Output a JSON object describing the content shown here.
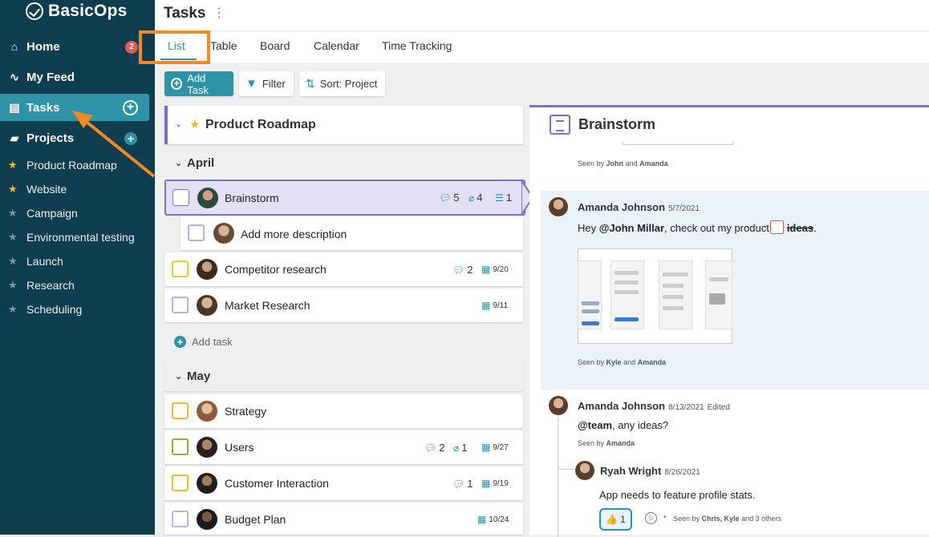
{
  "app": {
    "brand": "BasicOps"
  },
  "sidebar": {
    "nav": [
      {
        "label": "Home",
        "badge": "2"
      },
      {
        "label": "My Feed"
      },
      {
        "label": "Tasks"
      },
      {
        "label": "Projects"
      }
    ],
    "projects": [
      {
        "label": "Product Roadmap",
        "starred": true
      },
      {
        "label": "Website",
        "starred": true
      },
      {
        "label": "Campaign",
        "starred": false
      },
      {
        "label": "Environmental testing",
        "starred": false
      },
      {
        "label": "Launch",
        "starred": false
      },
      {
        "label": "Research",
        "starred": false
      },
      {
        "label": "Scheduling",
        "starred": false
      }
    ]
  },
  "header": {
    "title": "Tasks"
  },
  "tabs": [
    "List",
    "Table",
    "Board",
    "Calendar",
    "Time Tracking"
  ],
  "toolbar": {
    "add_task": "Add Task",
    "filter": "Filter",
    "sort": "Sort: Project"
  },
  "list": {
    "project": "Product Roadmap",
    "groups": [
      {
        "name": "April",
        "add_task": "Add task"
      },
      {
        "name": "May"
      }
    ],
    "tasks": [
      {
        "name": "Brainstorm",
        "comments": "5",
        "attachments": "4",
        "subtasks": "1"
      },
      {
        "name": "Add more description"
      },
      {
        "name": "Competitor research",
        "comments": "2",
        "date": "9/20"
      },
      {
        "name": "Market Research",
        "date": "9/11"
      },
      {
        "name": "Strategy"
      },
      {
        "name": "Users",
        "comments": "2",
        "attachments": "1",
        "date": "9/27"
      },
      {
        "name": "Customer Interaction",
        "comments": "1",
        "date": "9/19"
      },
      {
        "name": "Budget Plan",
        "date": "10/24"
      }
    ]
  },
  "detail": {
    "title": "Brainstorm",
    "seen1": {
      "prefix": "Seen by",
      "a": "John",
      "and": "and",
      "b": "Amanda"
    },
    "comments": [
      {
        "author": "Amanda Johnson",
        "date": "5/7/2021",
        "text_pre": "Hey ",
        "mention": "@John Millar",
        "text_mid": ", check out my product",
        "strike": "ideas",
        "text_end": ".",
        "seen": {
          "prefix": "Seen by",
          "a": "Kyle",
          "and": "and",
          "b": "Amanda"
        }
      },
      {
        "author": "Amanda Johnson",
        "date": "8/13/2021",
        "edited": "Edited",
        "mention": "@team",
        "text": ", any ideas?",
        "seen": {
          "prefix": "Seen by",
          "a": "Amanda"
        }
      },
      {
        "author": "Ryah Wright",
        "date": "8/26/2021",
        "text": "App needs to feature profile stats.",
        "reaction": {
          "emoji": "👍",
          "count": "1"
        },
        "seen": {
          "prefix": "Seen by",
          "a": "Chris, Kyle",
          "and": "and 3 others"
        }
      }
    ]
  },
  "colors": {
    "sidebar": "#0e3d4f",
    "accent": "#2e93a6",
    "highlight": "#f28a24",
    "purple": "#7b6ed6"
  }
}
